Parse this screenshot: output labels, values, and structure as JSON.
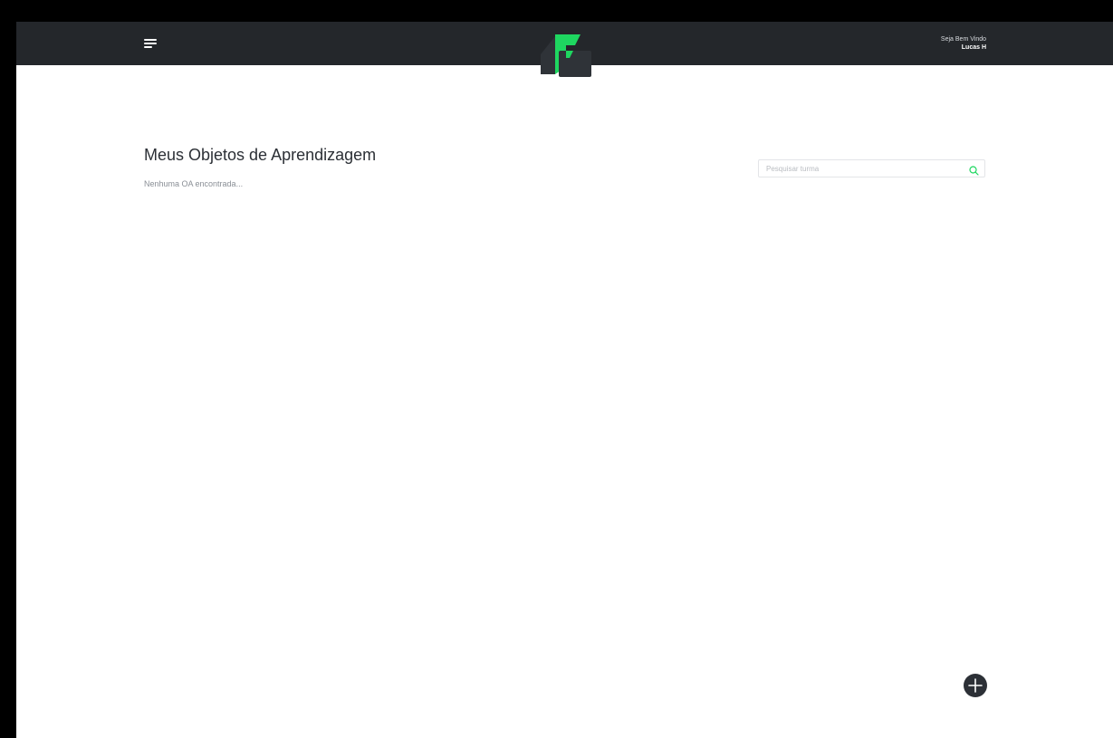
{
  "header": {
    "menu_icon": "hamburger-menu-icon",
    "logo_icon": "brand-logo-icon",
    "greeting": "Seja Bem Vindo",
    "username": "Lucas H"
  },
  "main": {
    "title": "Meus Objetos de Aprendizagem",
    "empty_message": "Nenhuma OA encontrada...",
    "search": {
      "placeholder": "Pesquisar turma",
      "value": "",
      "icon": "search-icon"
    },
    "add_button_icon": "plus-icon"
  },
  "colors": {
    "topbar": "#24272b",
    "accent_green": "#1ed760",
    "text_dark": "#2c3036",
    "fab": "#2c3036"
  }
}
